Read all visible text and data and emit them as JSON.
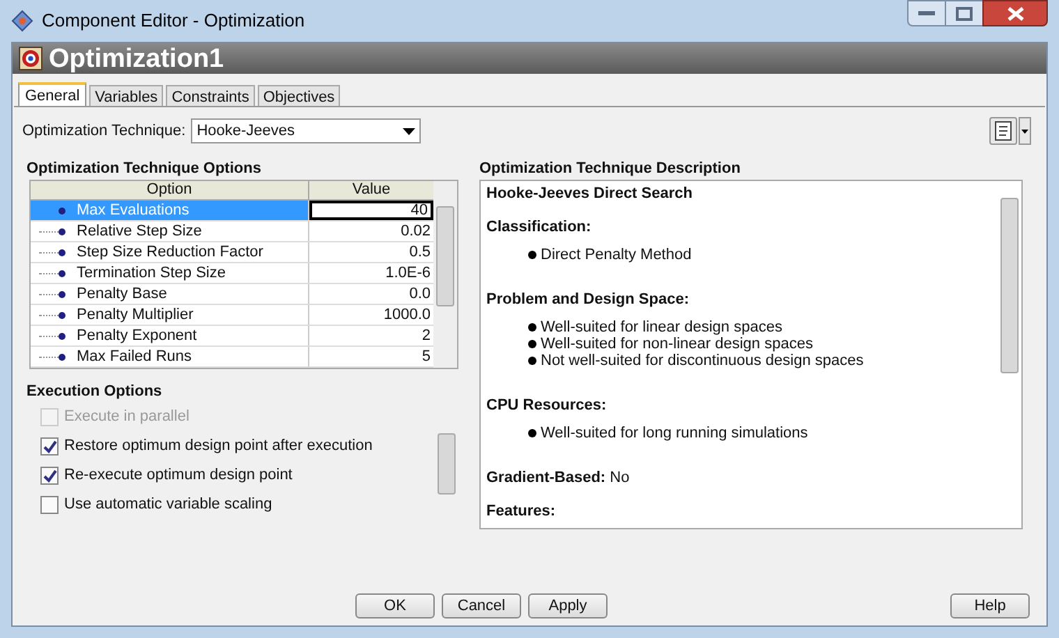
{
  "window": {
    "title": "Component Editor - Optimization"
  },
  "header": {
    "title": "Optimization1"
  },
  "tabs": [
    {
      "label": "General",
      "selected": true
    },
    {
      "label": "Variables",
      "selected": false
    },
    {
      "label": "Constraints",
      "selected": false
    },
    {
      "label": "Objectives",
      "selected": false
    }
  ],
  "technique": {
    "label": "Optimization Technique:",
    "value": "Hooke-Jeeves"
  },
  "options_panel": {
    "title": "Optimization Technique Options",
    "columns": [
      "Option",
      "Value"
    ],
    "rows": [
      {
        "option": "Max Evaluations",
        "value": "40",
        "selected": true
      },
      {
        "option": "Relative Step Size",
        "value": "0.02",
        "selected": false
      },
      {
        "option": "Step Size Reduction Factor",
        "value": "0.5",
        "selected": false
      },
      {
        "option": "Termination Step Size",
        "value": "1.0E-6",
        "selected": false
      },
      {
        "option": "Penalty Base",
        "value": "0.0",
        "selected": false
      },
      {
        "option": "Penalty Multiplier",
        "value": "1000.0",
        "selected": false
      },
      {
        "option": "Penalty Exponent",
        "value": "2",
        "selected": false
      },
      {
        "option": "Max Failed Runs",
        "value": "5",
        "selected": false
      }
    ]
  },
  "execution_options": {
    "title": "Execution Options",
    "items": [
      {
        "label": "Execute in parallel",
        "checked": false,
        "disabled": true
      },
      {
        "label": "Restore optimum design point after execution",
        "checked": true,
        "disabled": false
      },
      {
        "label": "Re-execute optimum design point",
        "checked": true,
        "disabled": false
      },
      {
        "label": "Use automatic variable scaling",
        "checked": false,
        "disabled": false
      }
    ]
  },
  "description": {
    "title": "Optimization Technique Description",
    "blocks": [
      {
        "kind": "heading",
        "text": "Hooke-Jeeves Direct Search"
      },
      {
        "kind": "heading",
        "text": "Classification:"
      },
      {
        "kind": "bullet",
        "text": "Direct Penalty Method"
      },
      {
        "kind": "heading",
        "text": "Problem and Design Space:"
      },
      {
        "kind": "bullet",
        "text": "Well-suited for linear design spaces"
      },
      {
        "kind": "bullet",
        "text": "Well-suited for non-linear design spaces"
      },
      {
        "kind": "bullet",
        "text": "Not well-suited for discontinuous design spaces"
      },
      {
        "kind": "heading",
        "text": "CPU Resources:"
      },
      {
        "kind": "bullet",
        "text": "Well-suited for long running simulations"
      },
      {
        "kind": "para",
        "text": "**Gradient-Based:** No"
      },
      {
        "kind": "heading",
        "text": "Features:"
      }
    ]
  },
  "buttons": [
    "OK",
    "Cancel",
    "Apply"
  ],
  "help_button": "Help"
}
